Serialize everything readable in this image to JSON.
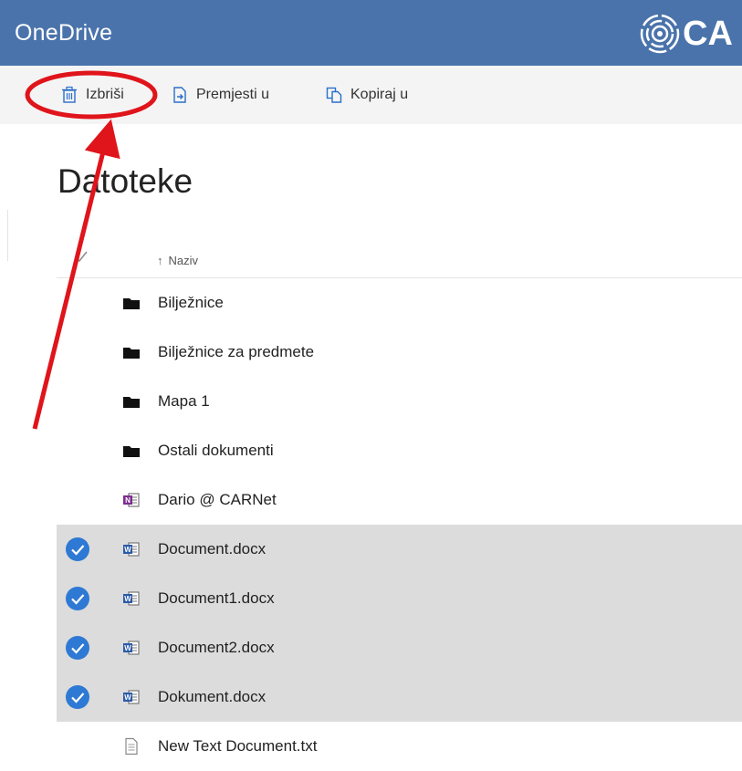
{
  "header": {
    "app_title": "OneDrive",
    "brand_text": "CA",
    "bg_color": "#4a73ab"
  },
  "toolbar": {
    "delete_label": "Izbriši",
    "move_label": "Premjesti u",
    "copy_label": "Kopiraj u"
  },
  "main": {
    "title": "Datoteke",
    "sort_arrow": "↑",
    "column_name": "Naziv"
  },
  "files": [
    {
      "name": "Bilježnice",
      "type": "folder",
      "selected": false
    },
    {
      "name": "Bilježnice za predmete",
      "type": "folder",
      "selected": false
    },
    {
      "name": "Mapa 1",
      "type": "folder",
      "selected": false
    },
    {
      "name": "Ostali dokumenti",
      "type": "folder",
      "selected": false
    },
    {
      "name": "Dario @ CARNet",
      "type": "onenote-icon",
      "selected": false
    },
    {
      "name": "Document.docx",
      "type": "word-icon",
      "selected": true
    },
    {
      "name": "Document1.docx",
      "type": "word-icon",
      "selected": true
    },
    {
      "name": "Document2.docx",
      "type": "word-icon",
      "selected": true
    },
    {
      "name": "Dokument.docx",
      "type": "word-icon",
      "selected": true
    },
    {
      "name": "New Text Document.txt",
      "type": "text-file-icon",
      "selected": false
    }
  ],
  "colors": {
    "accent": "#2e79d4",
    "selected_row": "#dcdcdc",
    "annotation": "#e0141b"
  }
}
